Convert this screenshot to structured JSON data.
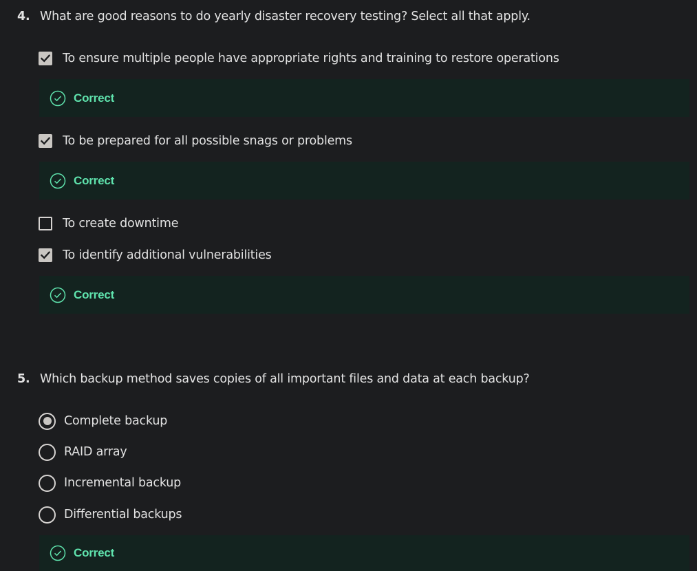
{
  "colors": {
    "background": "#1c1d1f",
    "correct_panel": "#13231f",
    "correct_text": "#5fe3ad",
    "control": "#c9c6c2"
  },
  "questions": [
    {
      "number": "4.",
      "text": "What are good reasons to do yearly disaster recovery testing? Select all that apply.",
      "input_type": "checkbox",
      "options": [
        {
          "label": "To ensure multiple people have appropriate rights and training to restore operations",
          "checked": true,
          "feedback": "Correct"
        },
        {
          "label": "To be prepared for all possible snags or problems",
          "checked": true,
          "feedback": "Correct"
        },
        {
          "label": "To create downtime",
          "checked": false,
          "feedback": ""
        },
        {
          "label": "To identify additional vulnerabilities",
          "checked": true,
          "feedback": "Correct"
        }
      ]
    },
    {
      "number": "5.",
      "text": "Which backup method saves copies of all important files and data at each backup?",
      "input_type": "radio",
      "options": [
        {
          "label": "Complete backup",
          "checked": true
        },
        {
          "label": "RAID array",
          "checked": false
        },
        {
          "label": "Incremental backup",
          "checked": false
        },
        {
          "label": "Differential backups",
          "checked": false
        }
      ],
      "feedback": "Correct"
    }
  ],
  "icons": {
    "check": "check-icon",
    "correct": "check-circle-icon"
  }
}
